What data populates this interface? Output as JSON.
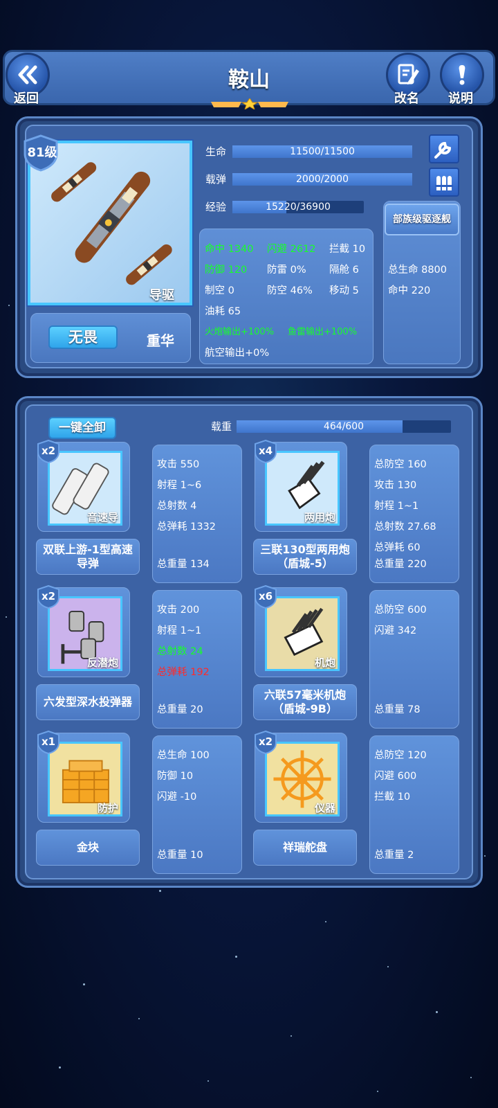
{
  "header": {
    "back_label": "返回",
    "title": "鞍山",
    "rename_label": "改名",
    "help_label": "说明",
    "stars": 1
  },
  "ship": {
    "level": "81级",
    "type_tag": "导驱",
    "skill_button": "无畏",
    "faction": "重华",
    "bars": {
      "hp": {
        "label": "生命",
        "value": "11500/11500",
        "fill": 1.0
      },
      "ammo": {
        "label": "载弹",
        "value": "2000/2000",
        "fill": 1.0
      },
      "exp": {
        "label": "经验",
        "value": "15220/36900",
        "fill": 0.41
      }
    },
    "stats": {
      "hit": "命中 1340",
      "evade": "闪避 2612",
      "intercept": "拦截 10",
      "defense": "防御 120",
      "torp_def": "防雷 0%",
      "bulkhead": "隔舱 6",
      "air_control": "制空 0",
      "aa": "防空 46%",
      "move": "移动 5",
      "fuel": "油耗 65",
      "gun_out": "火炮输出+100%",
      "torp_out": "鱼雷输出+100%",
      "air_out": "航空输出+0%"
    },
    "class_bonus": {
      "name": "部族级驱逐舰",
      "total_hp": "总生命 8800",
      "hit": "命中 220"
    }
  },
  "loadout": {
    "unequip_all": "一键全卸",
    "weight_label": "载重",
    "weight_value": "464/600",
    "weight_fill": 0.773
  },
  "equipment": [
    {
      "count": "x2",
      "kind": "音速导",
      "name": "双联上游-1型高速导弹",
      "stats": [
        "攻击 550",
        "射程 1~6",
        "总射数 4",
        "总弹耗 1332",
        "总重量 134"
      ],
      "colors": [
        "",
        "",
        "",
        "",
        ""
      ]
    },
    {
      "count": "x4",
      "kind": "两用炮",
      "name": "三联130型两用炮（盾城-5）",
      "stats": [
        "总防空 160",
        "攻击 130",
        "射程 1~1",
        "总射数 27.68",
        "总弹耗 60",
        "总重量 220"
      ],
      "colors": [
        "",
        "",
        "",
        "",
        "",
        ""
      ]
    },
    {
      "count": "x2",
      "kind": "反潜炮",
      "name": "六发型深水投弹器",
      "stats": [
        "攻击 200",
        "射程 1~1",
        "总射数 24",
        "总弹耗 192",
        "总重量 20"
      ],
      "colors": [
        "",
        "",
        "g",
        "r",
        ""
      ]
    },
    {
      "count": "x6",
      "kind": "机炮",
      "name": "六联57毫米机炮（盾城-9B）",
      "stats": [
        "总防空 600",
        "闪避 342",
        "总重量 78"
      ],
      "colors": [
        "",
        "",
        ""
      ]
    },
    {
      "count": "x1",
      "kind": "防护",
      "name": "金块",
      "stats": [
        "总生命 100",
        "防御 10",
        "闪避 -10",
        "总重量 10"
      ],
      "colors": [
        "",
        "",
        "",
        ""
      ]
    },
    {
      "count": "x2",
      "kind": "仪器",
      "name": "祥瑞舵盘",
      "stats": [
        "总防空 120",
        "闪避 600",
        "拦截 10",
        "总重量 2"
      ],
      "colors": [
        "",
        "",
        "",
        ""
      ]
    }
  ],
  "icons": [
    "double-chevron-left-icon",
    "rename-pencil-icon",
    "info-exclamation-icon",
    "wrench-icon",
    "ammo-icon",
    "star-icon"
  ]
}
